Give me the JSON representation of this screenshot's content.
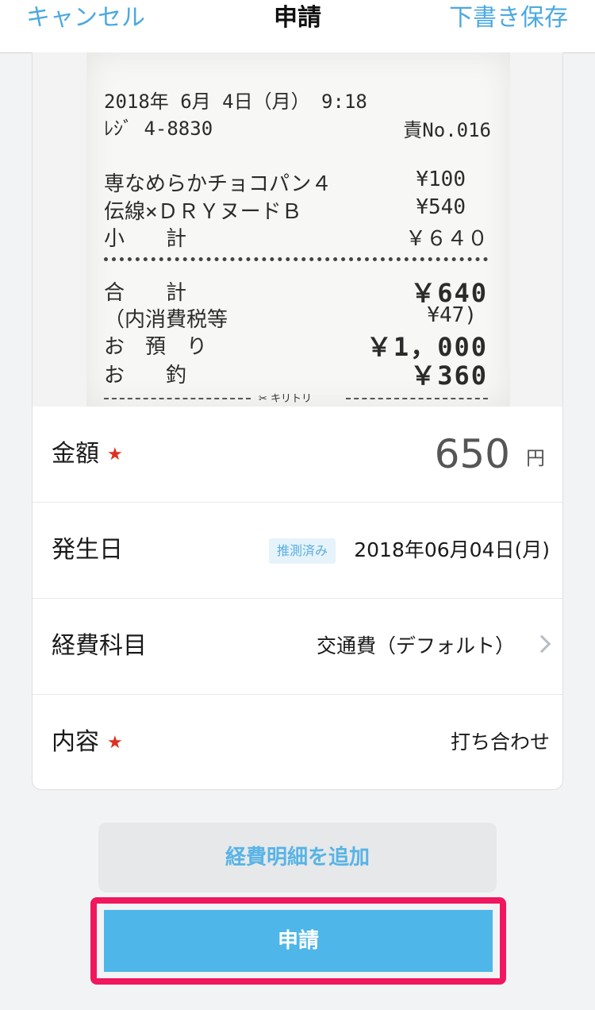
{
  "navbar": {
    "cancel_label": "キャンセル",
    "title": "申請",
    "save_draft_label": "下書き保存"
  },
  "receipt": {
    "date_line": "2018年 6月 4日（月） 9:18",
    "register_line": "ﾚｼﾞ 4-8830",
    "receipt_no": "責No.016",
    "items": [
      {
        "name": "専なめらかチョコパン４",
        "price": "¥100"
      },
      {
        "name": "伝線×ＤＲＹヌードＢ",
        "price": "¥540"
      }
    ],
    "subtotal_label": "小　　計",
    "subtotal_value": "￥６４０",
    "total_label": "合　　計",
    "total_value": "￥640",
    "tax_label": "（内消費税等",
    "tax_value": "¥47)",
    "deposit_label": "お　預　り",
    "deposit_value": "￥1，000",
    "change_label": "お　　釣",
    "change_value": "￥360",
    "cut_label": "✂ キリトリ"
  },
  "form": {
    "amount": {
      "label": "金額",
      "value": "650",
      "unit": "円",
      "required": "★"
    },
    "date": {
      "label": "発生日",
      "badge": "推測済み",
      "value": "2018年06月04日(月)"
    },
    "category": {
      "label": "経費科目",
      "value": "交通費（デフォルト）"
    },
    "content": {
      "label": "内容",
      "value": "打ち合わせ",
      "required": "★"
    }
  },
  "buttons": {
    "add_detail_label": "経費明細を追加",
    "submit_label": "申請"
  },
  "colors": {
    "accent": "#4ba9e0",
    "submit_bg": "#4eb6e8",
    "highlight": "#f0175e",
    "required": "#e0301e"
  }
}
